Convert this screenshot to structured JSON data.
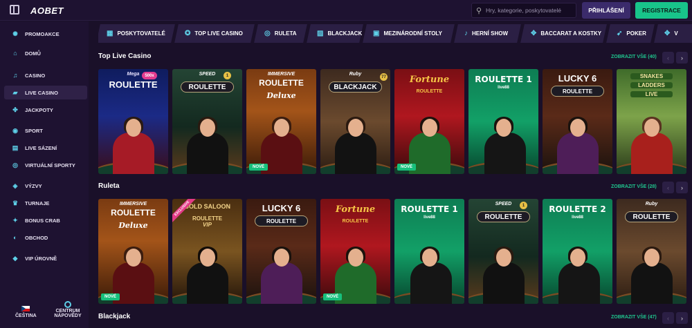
{
  "header": {
    "brand": "AOBET",
    "search_placeholder": "Hry, kategorie, poskytovatelé",
    "login_label": "PŘIHLÁŠENÍ",
    "register_label": "REGISTRACE",
    "accent_green": "#18c48a",
    "accent_cyan": "#5ed0e8"
  },
  "sidebar": {
    "items": [
      {
        "label": "PROMOAKCE",
        "icon": "promo-icon"
      },
      {
        "label": "DOMŮ",
        "icon": "home-icon"
      },
      {
        "label": "CASINO",
        "icon": "music-note-icon"
      },
      {
        "label": "LIVE CASINO",
        "icon": "live-casino-icon"
      },
      {
        "label": "JACKPOTY",
        "icon": "jackpot-icon"
      },
      {
        "label": "SPORT",
        "icon": "sport-icon"
      },
      {
        "label": "LIVE SÁZENÍ",
        "icon": "live-betting-icon"
      },
      {
        "label": "VIRTUÁLNÍ SPORTY",
        "icon": "virtual-sports-icon"
      },
      {
        "label": "VÝZVY",
        "icon": "challenge-icon"
      },
      {
        "label": "TURNAJE",
        "icon": "trophy-icon"
      },
      {
        "label": "BONUS CRAB",
        "icon": "crab-icon"
      },
      {
        "label": "OBCHOD",
        "icon": "shop-icon"
      },
      {
        "label": "VIP ÚROVNĚ",
        "icon": "vip-icon"
      }
    ],
    "language_label": "ČEŠTINA",
    "help_label_1": "CENTRUM",
    "help_label_2": "NÁPOVĚDY"
  },
  "categories": [
    {
      "label": "POSKYTOVATELÉ",
      "icon": "providers-icon"
    },
    {
      "label": "TOP LIVE CASINO",
      "icon": "star-icon"
    },
    {
      "label": "RULETA",
      "icon": "roulette-icon"
    },
    {
      "label": "BLACKJACK",
      "icon": "cards-icon"
    },
    {
      "label": "MEZINÁRODNÍ STOLY",
      "icon": "table-icon"
    },
    {
      "label": "HERNÍ SHOW",
      "icon": "mic-icon"
    },
    {
      "label": "BACCARAT A KOSTKY",
      "icon": "dice-icon"
    },
    {
      "label": "POKER",
      "icon": "poker-icon"
    },
    {
      "label": "V",
      "icon": "more-icon"
    }
  ],
  "sections": [
    {
      "title": "Top Live Casino",
      "show_all": "ZOBRAZIT VŠE (40)",
      "games": [
        {
          "line1": "Mega",
          "line2": "ROULETTE",
          "sub": "500x",
          "theme": "mega",
          "nove": false
        },
        {
          "line1": "SPEED",
          "line2": "ROULETTE",
          "sub": "1",
          "theme": "speed",
          "nove": false
        },
        {
          "line1": "IMMERSIVE",
          "line2": "ROULETTE",
          "line3": "Deluxe",
          "theme": "deluxe",
          "nove": true
        },
        {
          "line1": "Ruby",
          "line2": "BLACKJACK",
          "sub": "77",
          "theme": "ruby",
          "nove": false
        },
        {
          "line1": "Fortune",
          "line2": "ROULETTE",
          "theme": "fortune",
          "nove": true
        },
        {
          "line1": "ROULETTE 1",
          "line2": "live88",
          "theme": "green",
          "nove": false
        },
        {
          "line1": "LUCKY 6",
          "line2": "ROULETTE",
          "theme": "lucky",
          "nove": false
        },
        {
          "line1": "SNAKES",
          "line2": "LADDERS",
          "line3": "LIVE",
          "theme": "snakes",
          "nove": false
        }
      ]
    },
    {
      "title": "Ruleta",
      "show_all": "ZOBRAZIT VŠE (28)",
      "games": [
        {
          "line1": "IMMERSIVE",
          "line2": "ROULETTE",
          "line3": "Deluxe",
          "theme": "deluxe",
          "nove": true
        },
        {
          "line1": "GOLD SALOON",
          "line2": "ROULETTE",
          "line3": "VIP",
          "theme": "saloon",
          "nove": false,
          "ribbon": "EXCLUSIVE"
        },
        {
          "line1": "LUCKY 6",
          "line2": "ROULETTE",
          "theme": "lucky",
          "nove": false
        },
        {
          "line1": "Fortune",
          "line2": "ROULETTE",
          "theme": "fortune",
          "nove": true
        },
        {
          "line1": "ROULETTE 1",
          "line2": "live88",
          "theme": "green",
          "nove": false
        },
        {
          "line1": "SPEED",
          "line2": "ROULETTE",
          "sub": "1",
          "theme": "speed",
          "nove": false
        },
        {
          "line1": "ROULETTE 2",
          "line2": "live88",
          "theme": "green",
          "nove": false
        },
        {
          "line1": "Ruby",
          "line2": "ROULETTE",
          "theme": "ruby",
          "nove": false
        }
      ]
    },
    {
      "title": "Blackjack",
      "show_all": "ZOBRAZIT VŠE (47)",
      "games": []
    }
  ],
  "labels": {
    "nove": "NOVÉ",
    "prev": "‹",
    "next": "›"
  }
}
